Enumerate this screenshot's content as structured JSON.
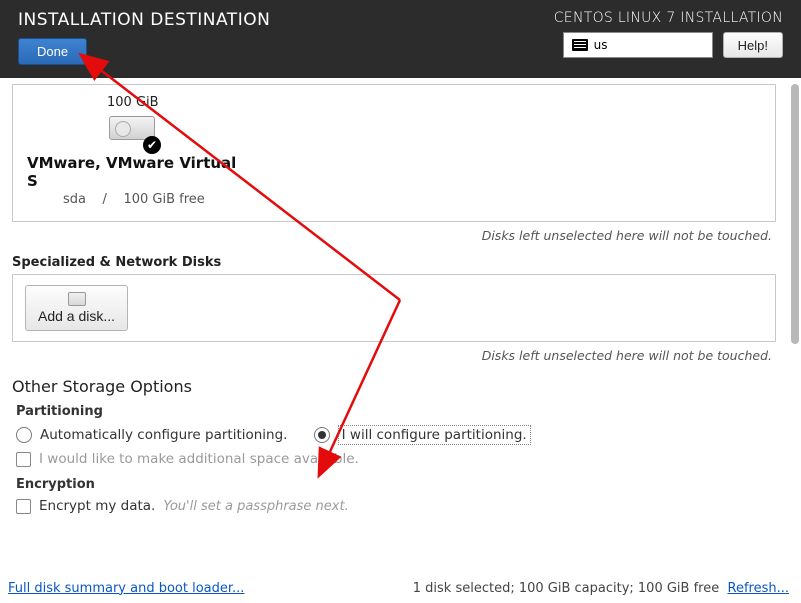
{
  "header": {
    "page_title": "INSTALLATION DESTINATION",
    "install_title": "CENTOS LINUX 7 INSTALLATION",
    "done_label": "Done",
    "keyboard_layout": "us",
    "help_label": "Help!"
  },
  "disks": {
    "local": [
      {
        "size": "100 GiB",
        "name": "VMware, VMware Virtual S",
        "dev": "sda",
        "sep": "/",
        "free": "100 GiB free",
        "selected": true
      }
    ],
    "hint_unselected": "Disks left unselected here will not be touched.",
    "network_section_label": "Specialized & Network Disks",
    "add_disk_label": "Add a disk..."
  },
  "storage": {
    "other_title": "Other Storage Options",
    "partitioning_label": "Partitioning",
    "auto_label": "Automatically configure partitioning.",
    "manual_label": "I will configure partitioning.",
    "partitioning_selected": "manual",
    "reclaim_label": "I would like to make additional space available.",
    "reclaim_checked": false,
    "encryption_label": "Encryption",
    "encrypt_label": "Encrypt my data.",
    "encrypt_hint": "You'll set a passphrase next.",
    "encrypt_checked": false
  },
  "footer": {
    "summary_link": "Full disk summary and boot loader...",
    "status": "1 disk selected;  100 GiB capacity;  100 GiB free",
    "refresh_link": "Refresh..."
  },
  "colors": {
    "header_bg": "#2c2c2c",
    "accent_blue": "#2a6bb8",
    "link_blue": "#0a57c2",
    "arrow_red": "#e30b0b"
  }
}
